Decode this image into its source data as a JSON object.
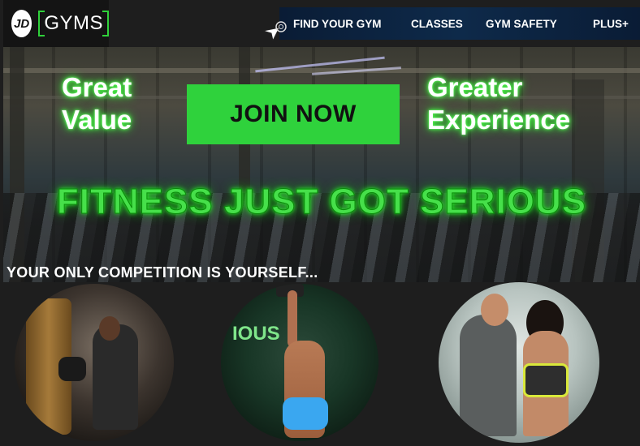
{
  "brand": {
    "logo_badge": "JD",
    "logo_text": "GYMS"
  },
  "nav": {
    "items": [
      {
        "label": "FIND YOUR GYM"
      },
      {
        "label": "CLASSES"
      },
      {
        "label": "GYM SAFETY"
      },
      {
        "label": "PLUS+"
      }
    ]
  },
  "hero": {
    "left_text_1": "Great",
    "left_text_2": "Value",
    "cta_label": "JOIN NOW",
    "right_text_1": "Greater",
    "right_text_2": "Experience",
    "headline": "FITNESS JUST GOT SERIOUS",
    "tagline": "YOUR ONLY COMPETITION IS YOURSELF..."
  },
  "colors": {
    "accent": "#2fd23c",
    "nav_bg": "#0e2a4a",
    "page_bg": "#1e1e1e",
    "glow": "#46e04a"
  },
  "icons": {
    "cursor": "pointer-cursor-icon"
  },
  "gallery": {
    "images": [
      {
        "icon": "boxing-photo"
      },
      {
        "icon": "weightlifting-photo"
      },
      {
        "icon": "personal-training-photo"
      }
    ]
  },
  "photo_text": {
    "sign": "IOUS"
  }
}
